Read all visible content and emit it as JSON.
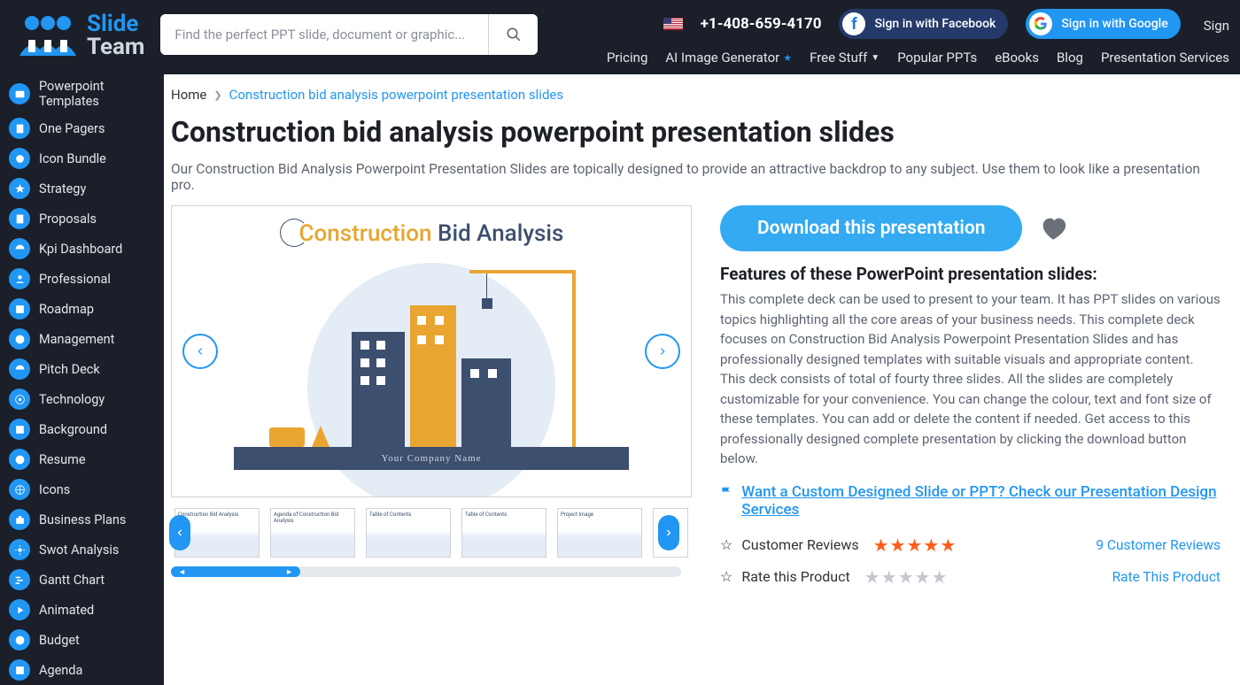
{
  "header": {
    "logo": {
      "line1": "Slide",
      "line2": "Team"
    },
    "search_placeholder": "Find the perfect PPT slide, document or graphic...",
    "phone": "+1-408-659-4170",
    "fb_label": "Sign in with Facebook",
    "google_label": "Sign in with Google",
    "sign_label": "Sign",
    "nav": [
      "Pricing",
      "AI Image Generator",
      "Free Stuff",
      "Popular PPTs",
      "eBooks",
      "Blog",
      "Presentation Services"
    ]
  },
  "sidebar": [
    "Powerpoint Templates",
    "One Pagers",
    "Icon Bundle",
    "Strategy",
    "Proposals",
    "Kpi Dashboard",
    "Professional",
    "Roadmap",
    "Management",
    "Pitch Deck",
    "Technology",
    "Background",
    "Resume",
    "Icons",
    "Business Plans",
    "Swot Analysis",
    "Gantt Chart",
    "Animated",
    "Budget",
    "Agenda"
  ],
  "breadcrumb": {
    "home": "Home",
    "current": "Construction bid analysis powerpoint presentation slides"
  },
  "page": {
    "title": "Construction bid analysis powerpoint presentation slides",
    "description": "Our Construction Bid Analysis Powerpoint Presentation Slides are topically designed to provide an attractive backdrop to any subject. Use them to look like a presentation pro."
  },
  "preview": {
    "slide_title_1": "Construction",
    "slide_title_2": "Bid Analysis",
    "company_label": "Your Company Name"
  },
  "thumbnails": [
    "Construction Bid Analysis",
    "Agenda of Construction Bid Analysis",
    "Table of Contents",
    "Table of Contents",
    "Project Image",
    ""
  ],
  "info": {
    "download_label": "Download this presentation",
    "features_title": "Features of these PowerPoint presentation slides:",
    "features_body": "This complete deck can be used to present to your team. It has PPT slides on various topics highlighting all the core areas of your business needs. This complete deck focuses on Construction Bid Analysis Powerpoint Presentation Slides and has professionally designed templates with suitable visuals and appropriate content. This deck consists of total of fourty three slides. All the slides are completely customizable for your convenience. You can change the colour, text and font size of these templates. You can add or delete the content if needed. Get access to this professionally designed complete presentation by clicking the download button below.",
    "custom_link": "Want a Custom Designed Slide or PPT? Check our Presentation Design Services",
    "reviews_label": "Customer Reviews",
    "reviews_count": "9  Customer Reviews",
    "rate_label": "Rate this Product",
    "rate_link": "Rate This Product"
  }
}
